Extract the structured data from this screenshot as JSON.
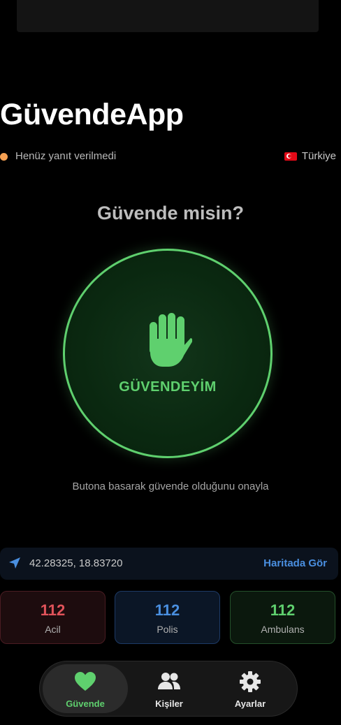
{
  "app": {
    "title": "GüvendeApp"
  },
  "status": {
    "text": "Henüz yanıt verilmedi",
    "dot_color": "#f5a052",
    "country": "Türkiye"
  },
  "prompt": {
    "question": "Güvende misin?"
  },
  "safe_button": {
    "label": "GÜVENDEYİM",
    "icon": "raised-hand-icon",
    "accent": "#5fd06e"
  },
  "hint": {
    "text": "Butona basarak güvende olduğunu onayla"
  },
  "location": {
    "coords": "42.28325, 18.83720",
    "map_link": "Haritada Gör",
    "icon": "location-arrow-icon"
  },
  "emergency": [
    {
      "number": "112",
      "label": "Acil",
      "color": "#e0535a"
    },
    {
      "number": "112",
      "label": "Polis",
      "color": "#4a8fe0"
    },
    {
      "number": "112",
      "label": "Ambulans",
      "color": "#5fd06e"
    }
  ],
  "tabs": [
    {
      "label": "Güvende",
      "icon": "heart-icon",
      "active": true
    },
    {
      "label": "Kişiler",
      "icon": "people-icon",
      "active": false
    },
    {
      "label": "Ayarlar",
      "icon": "gear-icon",
      "active": false
    }
  ]
}
